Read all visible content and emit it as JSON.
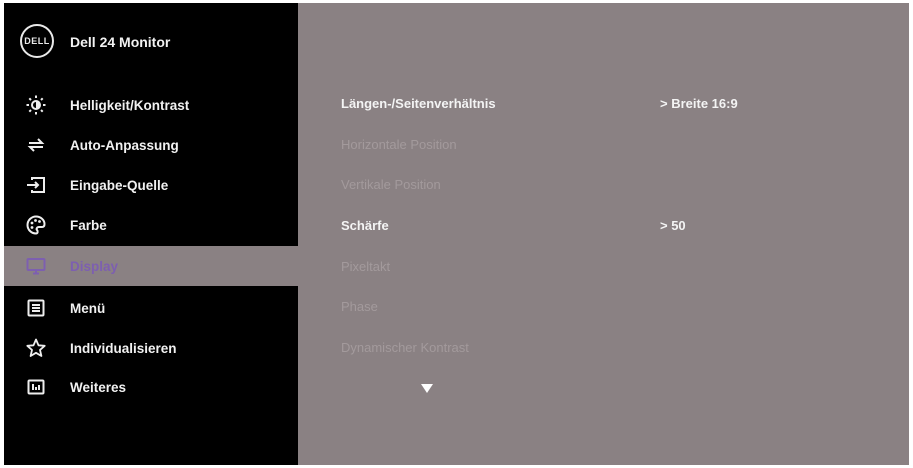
{
  "header": {
    "logo_text": "DELL",
    "title": "Dell 24 Monitor"
  },
  "sidebar": {
    "items": [
      {
        "label": "Helligkeit/Kontrast",
        "icon": "sun-icon",
        "active": false
      },
      {
        "label": "Auto-Anpassung",
        "icon": "auto-adjust-icon",
        "active": false
      },
      {
        "label": "Eingabe-Quelle",
        "icon": "input-source-icon",
        "active": false
      },
      {
        "label": "Farbe",
        "icon": "palette-icon",
        "active": false
      },
      {
        "label": "Display",
        "icon": "display-icon",
        "active": true
      },
      {
        "label": "Menü",
        "icon": "menu-icon",
        "active": false
      },
      {
        "label": "Individualisieren",
        "icon": "star-icon",
        "active": false
      },
      {
        "label": "Weiteres",
        "icon": "others-icon",
        "active": false
      }
    ]
  },
  "main": {
    "options": [
      {
        "label": "Längen-/Seitenverhältnis",
        "value": "> Breite 16:9",
        "enabled": true
      },
      {
        "label": "Horizontale Position",
        "value": "",
        "enabled": false
      },
      {
        "label": "Vertikale Position",
        "value": "",
        "enabled": false
      },
      {
        "label": "Schärfe",
        "value": "> 50",
        "enabled": true
      },
      {
        "label": "Pixeltakt",
        "value": "",
        "enabled": false
      },
      {
        "label": "Phase",
        "value": "",
        "enabled": false
      },
      {
        "label": "Dynamischer Kontrast",
        "value": "",
        "enabled": false
      }
    ],
    "scroll_icon": "down-arrow-icon"
  },
  "colors": {
    "sidebar_bg": "#000000",
    "panel_bg": "#8a8183",
    "active_label": "#7d5fb0",
    "text": "#f1f1f1",
    "disabled_text": "#a39a9c"
  }
}
